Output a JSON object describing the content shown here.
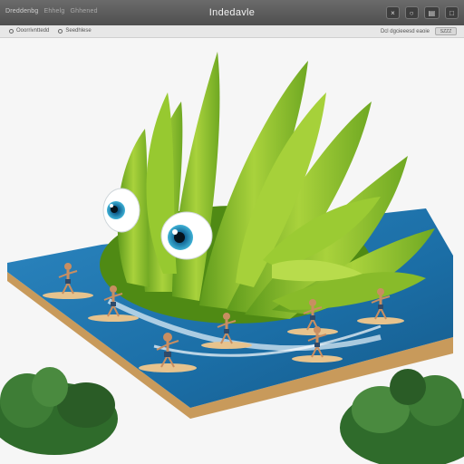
{
  "window": {
    "title": "Indedavle",
    "left_items": [
      "Dreddenbg",
      "Ehhelg",
      "Ghhened"
    ],
    "right_buttons": [
      "×",
      "○",
      "▤",
      "□"
    ]
  },
  "toolbar": {
    "left_items": [
      "Ooorrivnttedd",
      "Seedhlese"
    ],
    "right_label": "Dcl dgcieeesd eaoie",
    "field_value": "SZZZ"
  },
  "colors": {
    "titlebar": "#5a5a5a",
    "water": "#1f77b0",
    "creature_green": "#8cbf2a",
    "board_edge": "#c89a5b"
  }
}
